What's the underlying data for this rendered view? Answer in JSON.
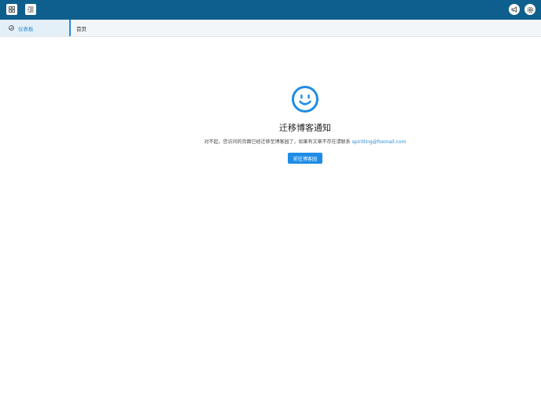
{
  "header": {
    "icons": [
      "grid-icon",
      "menu-indent-icon",
      "megaphone-icon",
      "settings-icon"
    ],
    "color": "#0f5f8e"
  },
  "tabs": {
    "active_label": "仪表板",
    "home_label": "首页",
    "active_color": "#2a8ad6"
  },
  "notice": {
    "title": "迁移博客通知",
    "message_prefix": "对不起，您访问的页面已经迁移至博客园了，如果有文章不存在请联系",
    "email": "spiritling@foxmail.com",
    "button_label": "前往博客园",
    "icon": "smile-icon",
    "accent": "#1f8ce6"
  }
}
